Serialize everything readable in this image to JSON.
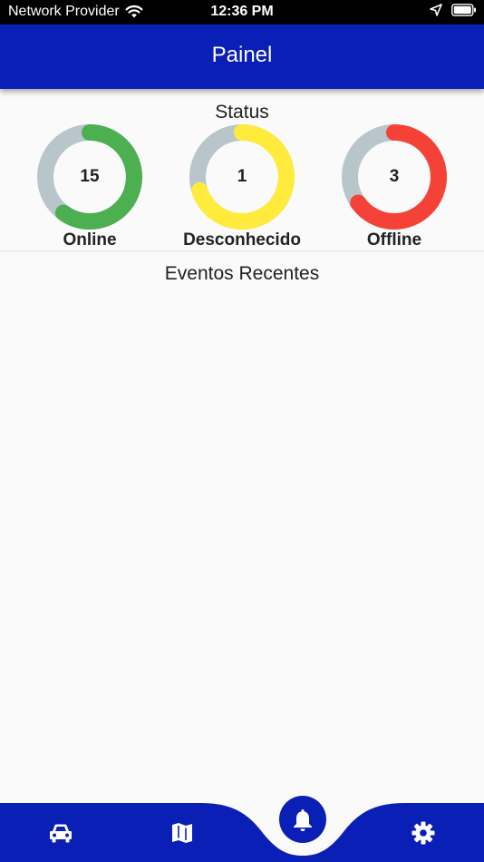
{
  "status_bar": {
    "carrier": "Network Provider",
    "time": "12:36 PM"
  },
  "app_bar": {
    "title": "Painel"
  },
  "status_section": {
    "title": "Status",
    "gauges": [
      {
        "label": "Online",
        "value": "15",
        "fraction": 0.6,
        "color": "#4caf50",
        "track_color": "#b8c6cc"
      },
      {
        "label": "Desconhecido",
        "value": "1",
        "fraction": 0.7,
        "color": "#ffeb3b",
        "track_color": "#b8c6cc"
      },
      {
        "label": "Offline",
        "value": "3",
        "fraction": 0.65,
        "color": "#f44336",
        "track_color": "#b8c6cc"
      }
    ]
  },
  "events_section": {
    "title": "Eventos Recentes"
  },
  "bottom_nav": {
    "items": [
      {
        "icon": "car-icon"
      },
      {
        "icon": "map-icon"
      },
      {
        "icon": "bell-icon",
        "active": true
      },
      {
        "icon": "gear-icon"
      }
    ],
    "color": "#0a1fb5"
  }
}
